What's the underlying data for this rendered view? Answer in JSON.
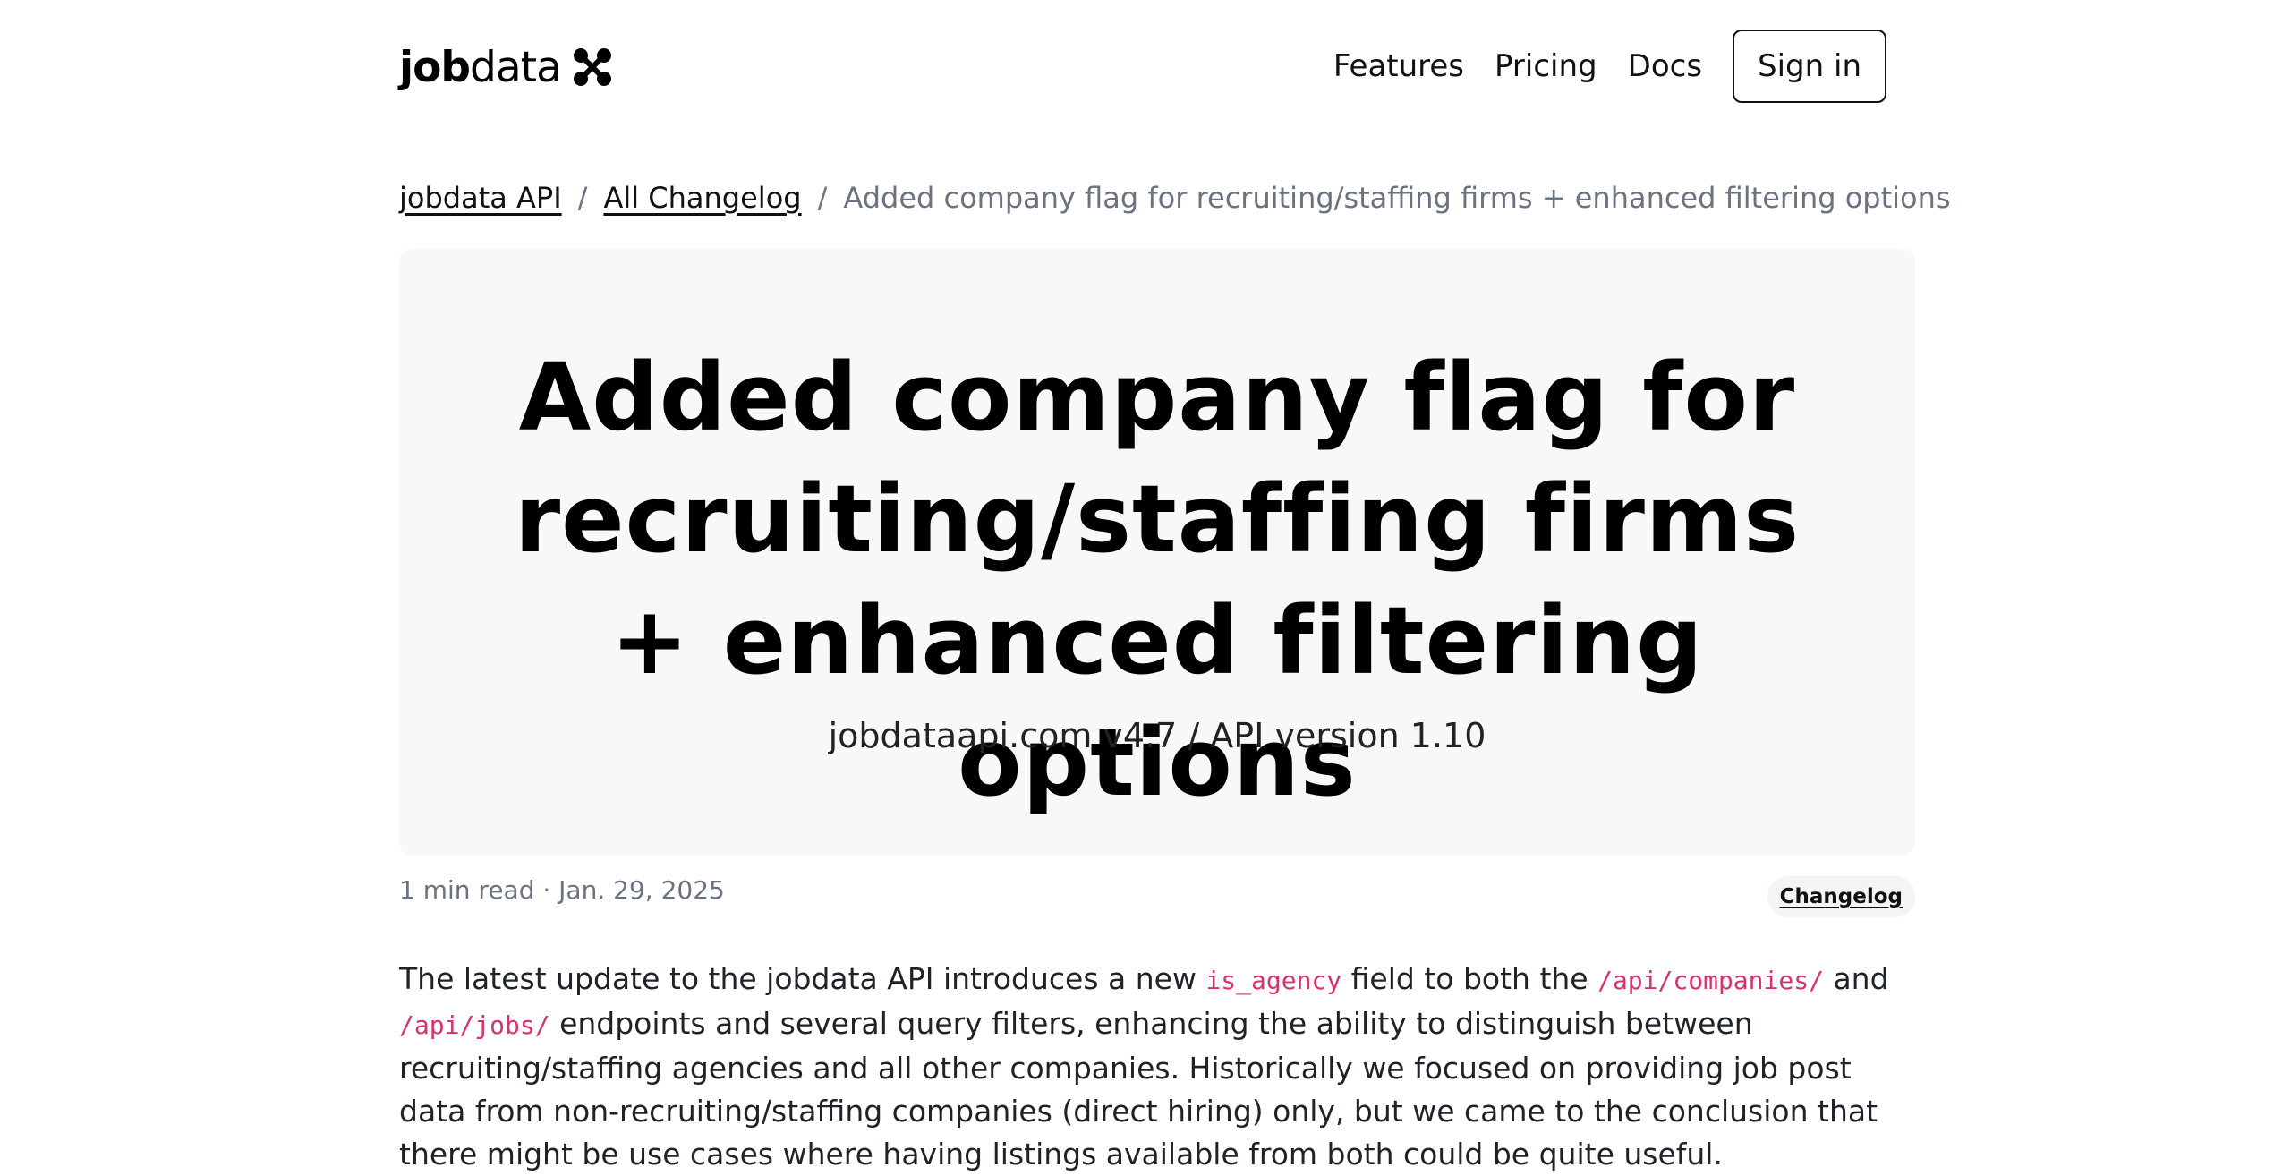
{
  "header": {
    "logo": {
      "bold": "job",
      "light": "data"
    },
    "nav": [
      "Features",
      "Pricing",
      "Docs"
    ],
    "signin_label": "Sign in"
  },
  "breadcrumb": {
    "items": [
      "jobdata API",
      "All Changelog"
    ],
    "separator": "/",
    "current": "Added company flag for recruiting/staffing firms + enhanced filtering options"
  },
  "hero": {
    "title": "Added company flag for recruiting/staffing firms + enhanced filtering options",
    "subtitle": "jobdataapi.com v4.7 / API version 1.10"
  },
  "meta": {
    "info": "1 min read · Jan. 29, 2025",
    "tag": "Changelog"
  },
  "article": {
    "t1": "The latest update to the jobdata API introduces a new ",
    "c1": "is_agency",
    "t2": " field to both the ",
    "c2": "/api/companies/",
    "t3": " and ",
    "c3": "/api/jobs/",
    "t4": " endpoints and several query filters, enhancing the ability to distinguish between recruiting/staffing agencies and all other companies. Historically we focused on providing job post data from non-recruiting/staffing companies (direct hiring) only, but we came to the conclusion that there might be use cases where having listings available from both could be quite useful."
  },
  "colors": {
    "code": "#d6336c",
    "card_bg": "#f7f8fa",
    "muted": "#6b7280"
  }
}
